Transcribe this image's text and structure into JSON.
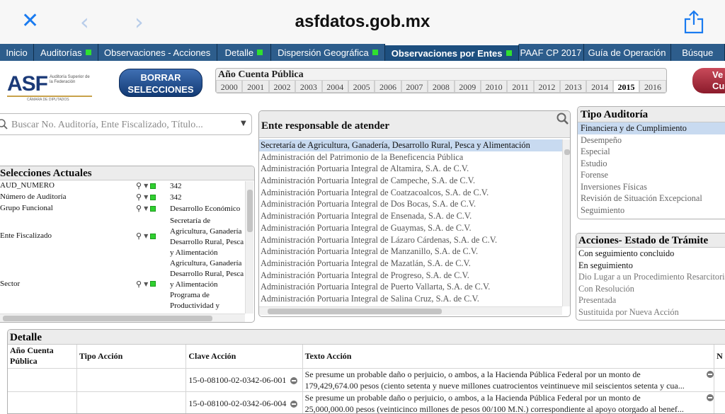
{
  "browser": {
    "url": "asfdatos.gob.mx",
    "close_icon": "close-icon",
    "back_icon": "chevron-left-icon",
    "forward_icon": "chevron-right-icon",
    "share_icon": "share-icon"
  },
  "nav": {
    "tabs": [
      {
        "label": "Inicio",
        "indicator": false
      },
      {
        "label": "Auditorías",
        "indicator": true
      },
      {
        "label": "Observaciones - Acciones",
        "indicator": false
      },
      {
        "label": "Detalle",
        "indicator": true
      },
      {
        "label": "Dispersión Geográfica",
        "indicator": true
      },
      {
        "label": "Observaciones por Entes",
        "indicator": true,
        "active": true
      },
      {
        "label": "PAAF CP 2017",
        "indicator": false
      },
      {
        "label": "Guía de Operación",
        "indicator": false
      },
      {
        "label": "Búsque",
        "indicator": false
      }
    ]
  },
  "header": {
    "logo_text": "ASF",
    "logo_sub": "Auditoría Superior de la Federación",
    "logo_footer": "CÁMARA DE DIPUTADOS",
    "clear_button": "BORRAR SELECCIONES",
    "red_button": "Ve Cue"
  },
  "years": {
    "title": "Año Cuenta Pública",
    "list": [
      "2000",
      "2001",
      "2002",
      "2003",
      "2004",
      "2005",
      "2006",
      "2007",
      "2008",
      "2009",
      "2010",
      "2011",
      "2012",
      "2013",
      "2014",
      "2015",
      "2016"
    ],
    "selected": "2015"
  },
  "search": {
    "placeholder": "Buscar No. Auditoría, Ente Fiscalizado, Título..."
  },
  "selections": {
    "title": "Selecciones Actuales",
    "rows": [
      {
        "label": "AUD_NUMERO",
        "value": "342"
      },
      {
        "label": "Número de Auditoría",
        "value": "342"
      },
      {
        "label": "Grupo Funcional",
        "value": "Desarrollo Económico"
      },
      {
        "label": "Ente Fiscalizado",
        "value_lines": [
          "Secretaría de",
          "Agricultura, Ganadería",
          "Desarrollo Rural, Pesca",
          "y Alimentación"
        ]
      },
      {
        "label": "Sector",
        "value_lines": [
          "Agricultura, Ganadería",
          "Desarrollo Rural, Pesca",
          "y Alimentación",
          "Programa de",
          "Productividad y"
        ]
      }
    ]
  },
  "ente": {
    "title": "Ente responsable de atender",
    "items": [
      "Secretaría de Agricultura, Ganadería, Desarrollo Rural, Pesca y Alimentación",
      "Administración del Patrimonio de la Beneficencia Pública",
      "Administración Portuaria Integral de Altamira, S.A. de C.V.",
      "Administración Portuaria Integral de Campeche, S.A. de C.V.",
      "Administración Portuaria Integral de Coatzacoalcos, S.A. de C.V.",
      "Administración Portuaria Integral de Dos Bocas, S.A. de C.V.",
      "Administración Portuaria Integral de Ensenada, S.A. de C.V.",
      "Administración Portuaria Integral de Guaymas, S.A. de C.V.",
      "Administración Portuaria Integral de Lázaro Cárdenas, S.A. de C.V.",
      "Administración Portuaria Integral de Manzanillo, S.A. de C.V.",
      "Administración Portuaria Integral de Mazatlán, S.A. de C.V.",
      "Administración Portuaria Integral de Progreso, S.A. de C.V.",
      "Administración Portuaria Integral de Puerto Vallarta, S.A. de C.V.",
      "Administración Portuaria Integral de Salina Cruz, S.A. de C.V."
    ]
  },
  "tipo": {
    "title": "Tipo Auditoría",
    "items": [
      "Financiera y de Cumplimiento",
      "Desempeño",
      "Especial",
      "Estudio",
      "Forense",
      "Inversiones Físicas",
      "Revisión de Situación Excepcional",
      "Seguimiento"
    ]
  },
  "acciones": {
    "title": "Acciones- Estado de Trámite",
    "items": [
      "Con seguimiento concluido",
      "En seguimiento",
      "Dio Lugar a un Procedimiento Resarcitorio",
      "Con Resolución",
      "Presentada",
      "Sustituida por Nueva Acción"
    ]
  },
  "detalle": {
    "title": "Detalle",
    "columns": [
      "Año Cuenta Pública",
      "Tipo Acción",
      "Clave Acción",
      "Texto Acción",
      "N"
    ],
    "rows": [
      {
        "clave": "15-0-08100-02-0342-06-001",
        "texto": [
          "Se presume un probable daño o perjuicio, o ambos, a la Hacienda Pública Federal por un monto de",
          "179,429,674.00 pesos (ciento setenta y nueve millones cuatrocientos veintinueve mil seiscientos setenta y cua..."
        ]
      },
      {
        "clave": "15-0-08100-02-0342-06-004",
        "texto": [
          "Se presume un probable daño o perjuicio, o ambos, a la Hacienda Pública Federal por un monto de",
          "25,000,000.00 pesos (veinticinco millones de pesos 00/100 M.N.) correspondiente al apoyo otorgado al benef..."
        ]
      }
    ]
  },
  "colors": {
    "nav_bg": "#2d5d8c",
    "indicator": "#30e030",
    "selection_bg": "#c8daf0",
    "ios_blue": "#1a7bf0"
  }
}
